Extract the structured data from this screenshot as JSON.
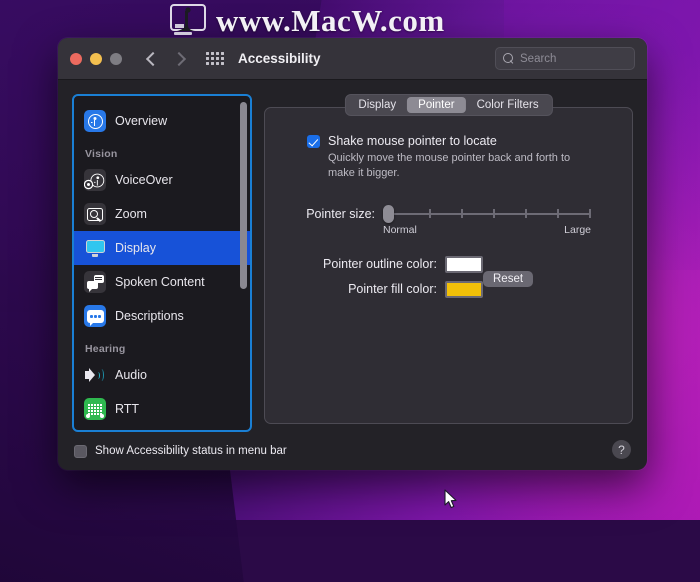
{
  "watermark": {
    "text": "www.MacW.com",
    "logo_icon": "imac-computer-icon"
  },
  "window": {
    "title": "Accessibility",
    "traffic_lights": [
      "close-red",
      "minimize-yellow",
      "zoom-gray-disabled"
    ],
    "nav": {
      "back_icon": "chevron-left-icon",
      "forward_icon": "chevron-right-icon",
      "show_all_icon": "grid-dots-icon"
    },
    "search": {
      "placeholder": "Search",
      "value": "",
      "icon": "search-icon"
    }
  },
  "sidebar": {
    "items": [
      {
        "label": "Overview",
        "icon": "accessibility-person-icon",
        "type": "item",
        "selected": false
      },
      {
        "label": "Vision",
        "type": "group"
      },
      {
        "label": "VoiceOver",
        "icon": "voiceover-icon",
        "type": "item",
        "selected": false
      },
      {
        "label": "Zoom",
        "icon": "zoom-magnifier-icon",
        "type": "item",
        "selected": false
      },
      {
        "label": "Display",
        "icon": "display-monitor-icon",
        "type": "item",
        "selected": true
      },
      {
        "label": "Spoken Content",
        "icon": "speech-bubbles-icon",
        "type": "item",
        "selected": false
      },
      {
        "label": "Descriptions",
        "icon": "caption-bubble-icon",
        "type": "item",
        "selected": false
      },
      {
        "label": "Hearing",
        "type": "group"
      },
      {
        "label": "Audio",
        "icon": "speaker-waves-icon",
        "type": "item",
        "selected": false
      },
      {
        "label": "RTT",
        "icon": "rtt-teletype-icon",
        "type": "item",
        "selected": false
      }
    ],
    "scrollbar": {
      "thumb_percent": 58
    }
  },
  "main": {
    "tabs": [
      {
        "label": "Display",
        "active": false
      },
      {
        "label": "Pointer",
        "active": true
      },
      {
        "label": "Color Filters",
        "active": false
      }
    ],
    "shake_pointer": {
      "label": "Shake mouse pointer to locate",
      "checked": true,
      "description": "Quickly move the mouse pointer back and forth to make it bigger."
    },
    "pointer_size": {
      "label": "Pointer size:",
      "min_label": "Normal",
      "max_label": "Large",
      "value_percent": 0,
      "tick_count": 6
    },
    "outline_color": {
      "label": "Pointer outline color:",
      "value": "#ffffff"
    },
    "fill_color": {
      "label": "Pointer fill color:",
      "value": "#f2c008"
    },
    "reset_button": {
      "label": "Reset"
    }
  },
  "footer": {
    "menu_bar_status": {
      "label": "Show Accessibility status in menu bar",
      "checked": false
    },
    "help_button": {
      "label": "?",
      "icon": "help-question-icon"
    }
  }
}
